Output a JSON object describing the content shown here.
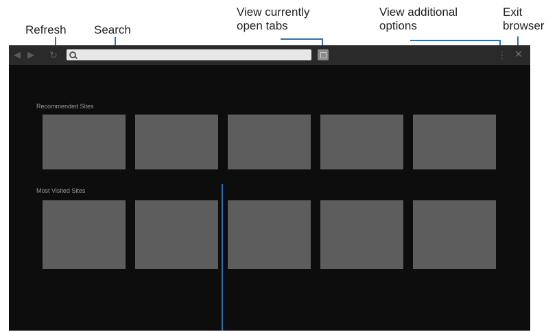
{
  "callouts": {
    "refresh": "Refresh",
    "search": "Search",
    "tabs_line1": "View currently",
    "tabs_line2": "open tabs",
    "options_line1": "View additional",
    "options_line2": "options",
    "exit_line1": "Exit",
    "exit_line2": "browser"
  },
  "browser": {
    "toolbar": {
      "back_icon": "back-arrow",
      "forward_icon": "forward-arrow",
      "refresh_icon": "refresh-arrow",
      "search_icon": "magnifier",
      "url_value": "",
      "tabs_icon": "tabs-square",
      "options_icon": "vertical-ellipsis",
      "exit_icon": "close-x"
    },
    "recommended": {
      "label": "Recommended Sites"
    },
    "most_visited": {
      "label": "Most Visited Sites"
    }
  },
  "colors": {
    "leader": "#2e6fb0",
    "page_bg": "#0d0d0d",
    "toolbar_bg": "#2a2a2a",
    "tile": "#5d5d5d"
  }
}
